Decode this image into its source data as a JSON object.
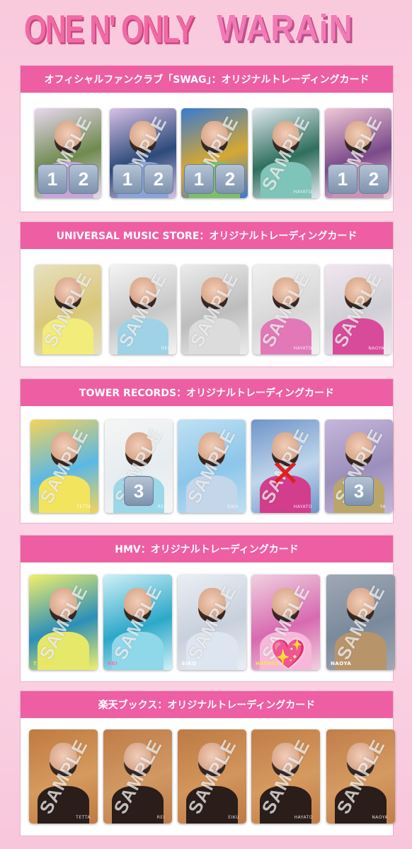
{
  "header": {
    "left_logo": "ONE N' ONLY",
    "right_logo": "WARAiN"
  },
  "overlays": {
    "sample_text": "SAMPLE"
  },
  "sections": [
    {
      "title": "オフィシャルファンクラブ「SWAG」：オリジナルトレーディングカード",
      "cards": [
        {
          "badges": [
            "1",
            "2"
          ],
          "name": ""
        },
        {
          "badges": [
            "1",
            "2"
          ],
          "name": ""
        },
        {
          "badges": [
            "1",
            "2"
          ],
          "name": ""
        },
        {
          "badges": [],
          "name": "HAYATO"
        },
        {
          "badges": [
            "1",
            "2"
          ],
          "name": ""
        }
      ]
    },
    {
      "title": "UNIVERSAL MUSIC STORE：オリジナルトレーディングカード",
      "cards": [
        {
          "badges": [],
          "name": ""
        },
        {
          "badges": [],
          "name": "REI"
        },
        {
          "badges": [],
          "name": ""
        },
        {
          "badges": [],
          "name": "HAYATO"
        },
        {
          "badges": [],
          "name": "NAOYA"
        }
      ]
    },
    {
      "title": "TOWER RECORDS：オリジナルトレーディングカード",
      "cards": [
        {
          "badges": [],
          "name": "TETTA"
        },
        {
          "badges": [
            "3"
          ],
          "name": "REI"
        },
        {
          "badges": [],
          "name": "EIKU"
        },
        {
          "badges": [],
          "name": "HAYATO",
          "mark": "✕"
        },
        {
          "badges": [
            "3"
          ],
          "name": "YA"
        }
      ]
    },
    {
      "title": "HMV：オリジナルトレーディングカード",
      "cards": [
        {
          "badges": [],
          "name": "TETTA"
        },
        {
          "badges": [],
          "name": "REI"
        },
        {
          "badges": [],
          "name": "EIKU"
        },
        {
          "badges": [],
          "name": "HAYATO",
          "mark": "💖"
        },
        {
          "badges": [],
          "name": "NAOYA"
        }
      ]
    },
    {
      "title": "楽天ブックス：オリジナルトレーディングカード",
      "cards": [
        {
          "badges": [],
          "name": "TETTA"
        },
        {
          "badges": [],
          "name": "REI"
        },
        {
          "badges": [],
          "name": "EIKU"
        },
        {
          "badges": [],
          "name": "HAYATO"
        },
        {
          "badges": [],
          "name": "NAOYA"
        }
      ]
    }
  ],
  "colors": {
    "section_header_bg": "#ee5ea2",
    "page_bg": "#fbd7e6",
    "badge_bg": "#8ea0b8",
    "cross_mark": "#e0201f",
    "heart_mark": "#ff4fb0"
  },
  "icons": {
    "cross": "cross-mark-icon",
    "heart": "sparkling-heart-icon",
    "number_badge": "keycap-number-icon"
  }
}
